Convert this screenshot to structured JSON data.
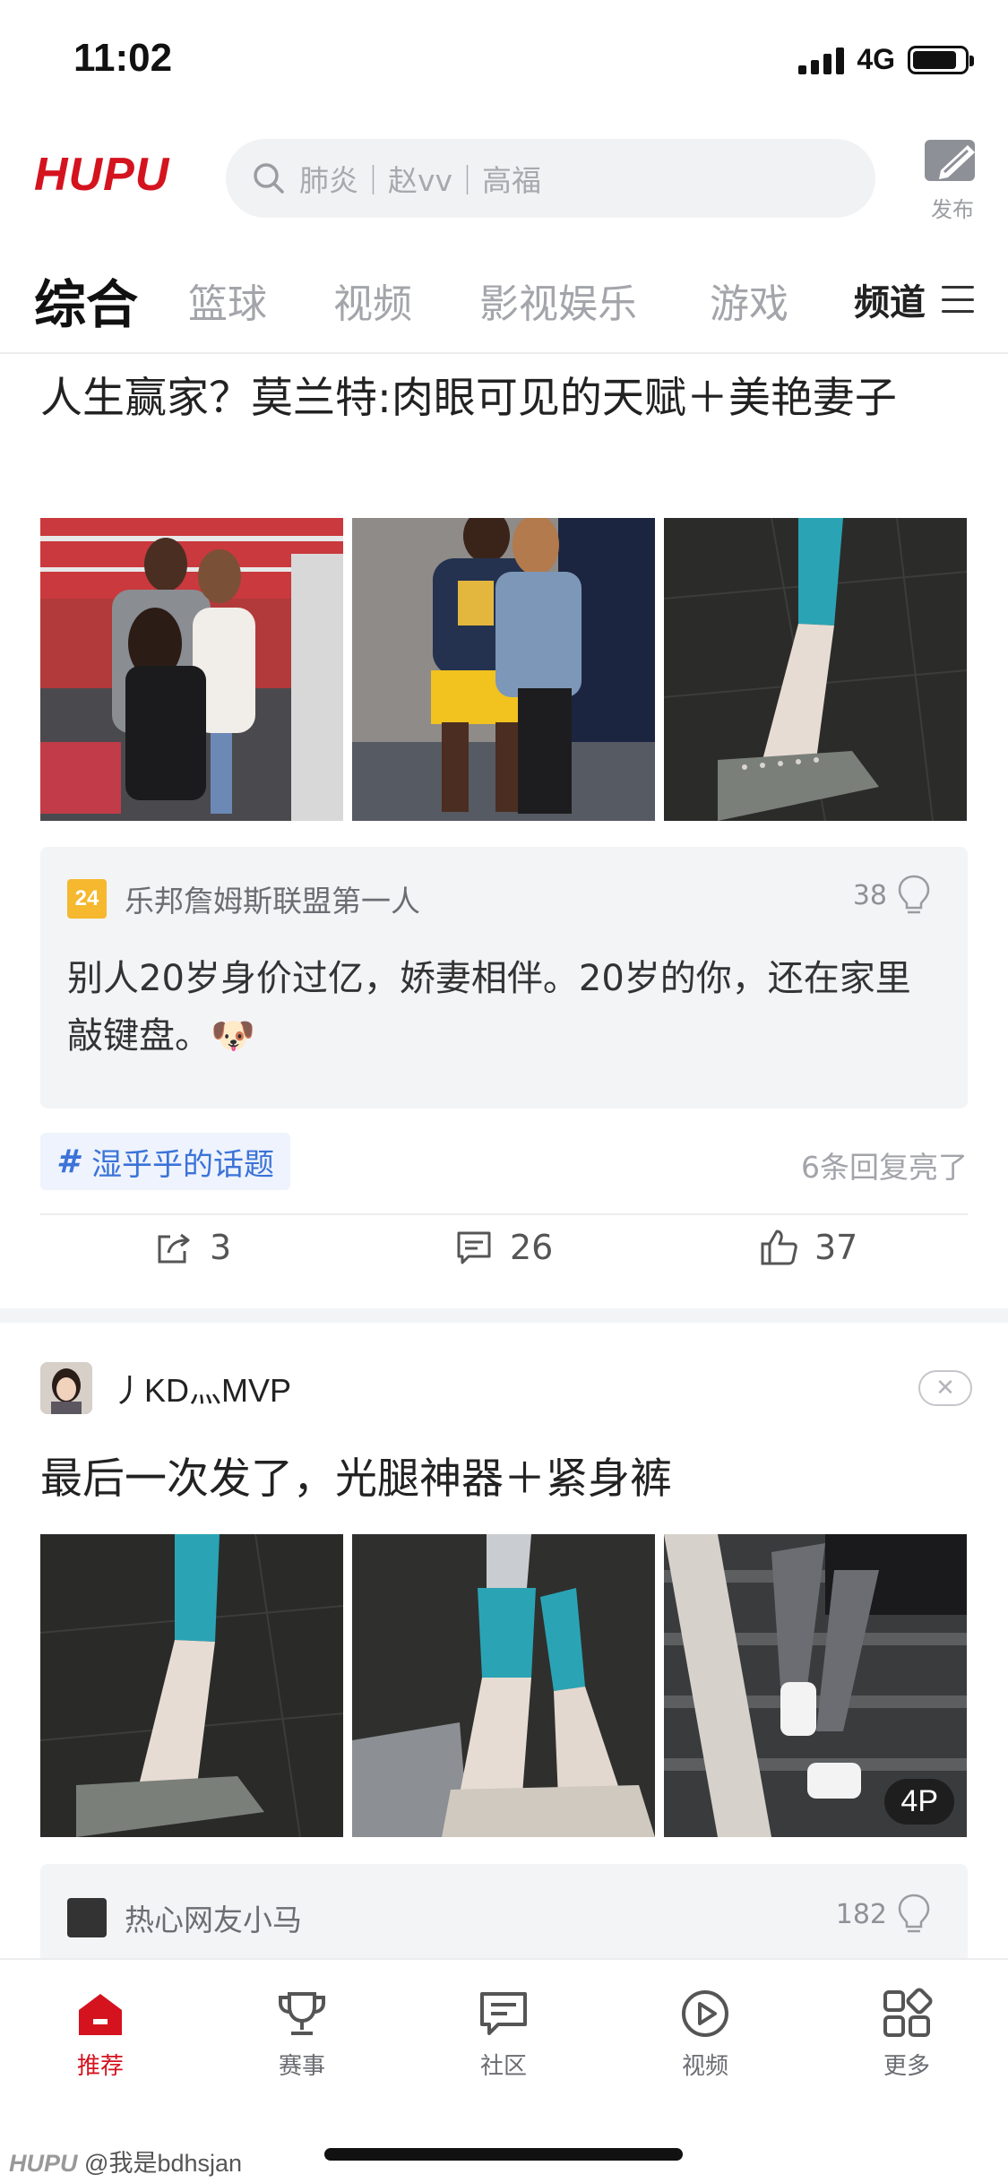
{
  "status": {
    "time": "11:02",
    "network": "4G",
    "battery_level": 0.85
  },
  "header": {
    "logo": "HUPU",
    "search_placeholder": "肺炎｜赵vv｜高福",
    "publish_label": "发布"
  },
  "tabs": {
    "items": [
      "综合",
      "篮球",
      "视频",
      "影视娱乐",
      "游戏"
    ],
    "active": "综合",
    "channel_label": "频道"
  },
  "post1": {
    "title": "人生赢家？莫兰特:肉眼可见的天赋＋美艳妻子",
    "comment": {
      "level": "24",
      "user": "乐邦詹姆斯联盟第一人",
      "lights": "38",
      "text": "别人20岁身价过亿，娇妻相伴。20岁的你，还在家里敲键盘。🐶"
    },
    "topic": "湿乎乎的话题",
    "replies_note": "6条回复亮了",
    "shares": "3",
    "comments": "26",
    "likes": "37"
  },
  "post2": {
    "author": "丿KD灬MVP",
    "title": "最后一次发了，光腿神器＋紧身裤",
    "image_count_badge": "4P",
    "comment": {
      "user": "热心网友小马",
      "lights": "182"
    }
  },
  "bottom_nav": {
    "items": [
      "推荐",
      "赛事",
      "社区",
      "视频",
      "更多"
    ],
    "active": "推荐"
  },
  "watermark": {
    "brand": "HUPU",
    "handle": "@我是bdhsjan"
  },
  "colors": {
    "brand_red": "#d4131f",
    "topic_blue": "#3b73d8"
  }
}
